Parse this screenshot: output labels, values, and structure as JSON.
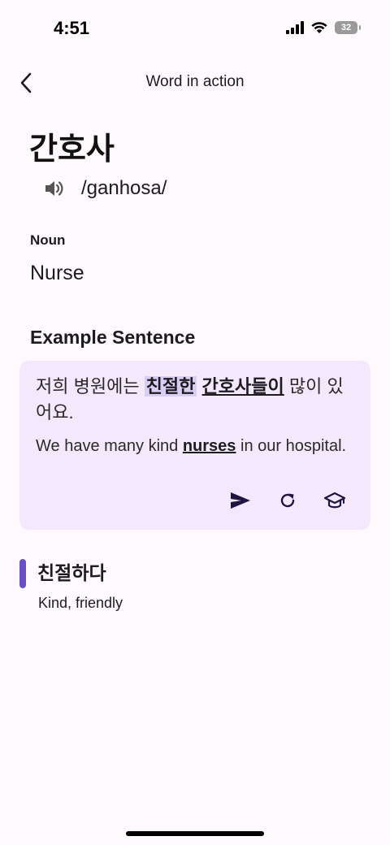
{
  "status_bar": {
    "time": "4:51",
    "battery_level": "32"
  },
  "nav": {
    "back_icon": "chevron-left-icon",
    "title": "Word in action"
  },
  "word": {
    "term": "간호사",
    "pronunciation": "/ganhosa/",
    "speaker_icon": "speaker-icon",
    "part_of_speech": "Noun",
    "meaning": "Nurse"
  },
  "example": {
    "section_title": "Example Sentence",
    "korean": {
      "before": "저희 병원에는 ",
      "highlight": "친절한",
      "between": " ",
      "target": "간호사들이",
      "after": " 많이 있어요."
    },
    "english": {
      "before": "We have many kind ",
      "target": "nurses",
      "after": " in our hospital."
    },
    "actions": [
      {
        "icon": "send-icon"
      },
      {
        "icon": "refresh-icon"
      },
      {
        "icon": "graduation-cap-icon"
      }
    ]
  },
  "vocab": {
    "word": "친절하다",
    "meaning": "Kind, friendly",
    "accent_color": "#6a4fc8"
  },
  "colors": {
    "background": "#fdf9fd",
    "card_background": "#f3e8fc",
    "highlight": "#d9cdf4",
    "accent": "#6a4fc8"
  }
}
